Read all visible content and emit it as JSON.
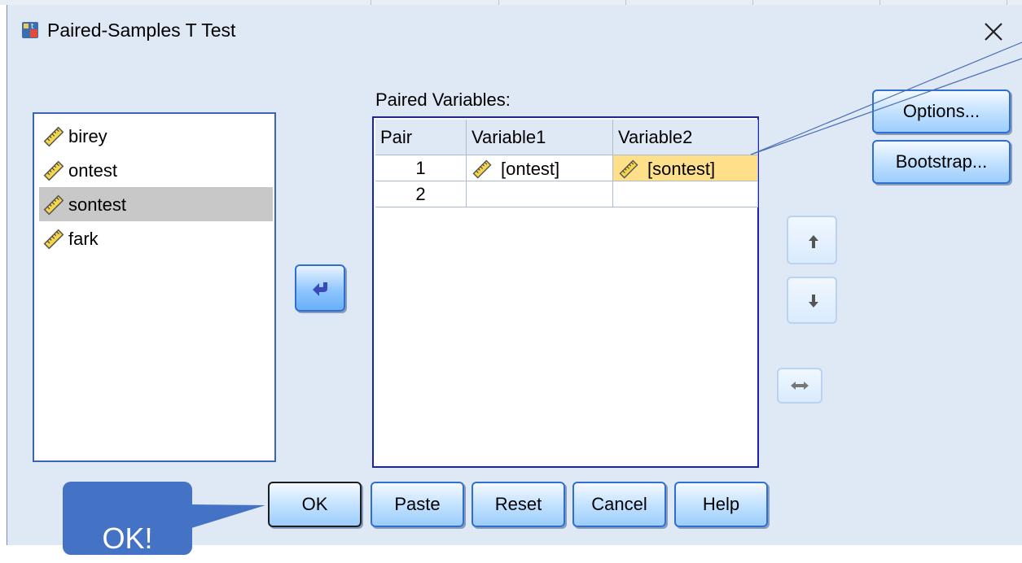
{
  "window": {
    "title": "Paired-Samples T Test",
    "close_icon": "close-icon",
    "app_icon": "spss-t-test-icon"
  },
  "variable_list": [
    {
      "label": "birey",
      "icon": "scale-ruler-icon",
      "selected": false
    },
    {
      "label": "ontest",
      "icon": "scale-ruler-icon",
      "selected": false
    },
    {
      "label": "sontest",
      "icon": "scale-ruler-icon",
      "selected": true
    },
    {
      "label": "fark",
      "icon": "scale-ruler-icon",
      "selected": false
    }
  ],
  "move_button": {
    "icon": "arrow-left-icon"
  },
  "paired": {
    "label": "Paired Variables:",
    "columns": [
      "Pair",
      "Variable1",
      "Variable2"
    ],
    "rows": [
      {
        "pair": "1",
        "var1": "[ontest]",
        "var2": "[sontest]"
      },
      {
        "pair": "2",
        "var1": "",
        "var2": ""
      }
    ]
  },
  "side_buttons": {
    "up_icon": "arrow-up-icon",
    "down_icon": "arrow-down-icon",
    "swap_icon": "swap-horizontal-icon"
  },
  "right_buttons": {
    "options": "Options...",
    "bootstrap": "Bootstrap..."
  },
  "bottom_buttons": {
    "ok": "OK",
    "paste": "Paste",
    "reset": "Reset",
    "cancel": "Cancel",
    "help": "Help"
  },
  "callout": {
    "text": "OK!"
  },
  "colors": {
    "dialog_bg": "#dfe8f5",
    "accent": "#2e6fd1",
    "highlight": "#ffe08a",
    "callout": "#4472c4"
  }
}
